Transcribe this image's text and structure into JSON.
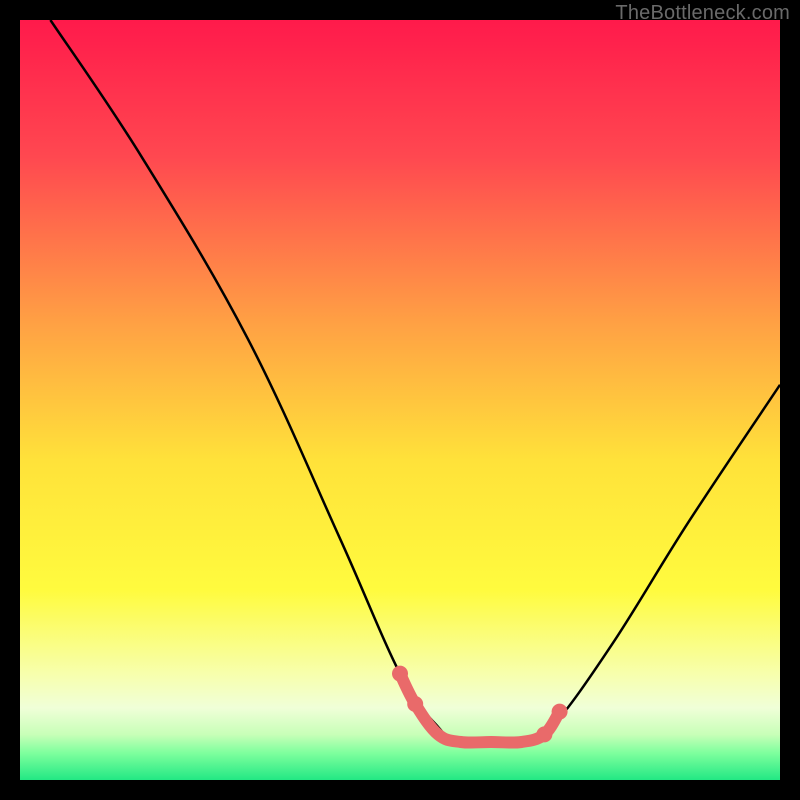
{
  "watermark": "TheBottleneck.com",
  "chart_data": {
    "type": "line",
    "title": "",
    "xlabel": "",
    "ylabel": "",
    "xlim": [
      0,
      100
    ],
    "ylim": [
      0,
      100
    ],
    "gradient_stops": [
      {
        "offset": 0,
        "color": "#ff1a4b"
      },
      {
        "offset": 0.18,
        "color": "#ff4850"
      },
      {
        "offset": 0.4,
        "color": "#ffa144"
      },
      {
        "offset": 0.58,
        "color": "#ffe23a"
      },
      {
        "offset": 0.75,
        "color": "#fffb3e"
      },
      {
        "offset": 0.86,
        "color": "#f7ffac"
      },
      {
        "offset": 0.905,
        "color": "#f0ffd8"
      },
      {
        "offset": 0.94,
        "color": "#c8ffb8"
      },
      {
        "offset": 0.965,
        "color": "#7dff9d"
      },
      {
        "offset": 1.0,
        "color": "#22e884"
      }
    ],
    "series": [
      {
        "name": "bottleneck-curve",
        "color": "#000000",
        "points": [
          {
            "x": 4,
            "y": 100
          },
          {
            "x": 16,
            "y": 82
          },
          {
            "x": 30,
            "y": 58
          },
          {
            "x": 42,
            "y": 32
          },
          {
            "x": 50,
            "y": 14
          },
          {
            "x": 55,
            "y": 7
          },
          {
            "x": 58,
            "y": 5
          },
          {
            "x": 66,
            "y": 5
          },
          {
            "x": 70,
            "y": 7
          },
          {
            "x": 78,
            "y": 18
          },
          {
            "x": 88,
            "y": 34
          },
          {
            "x": 100,
            "y": 52
          }
        ]
      },
      {
        "name": "highlight-segment",
        "color": "#e96a6a",
        "points": [
          {
            "x": 50,
            "y": 14
          },
          {
            "x": 52,
            "y": 10
          },
          {
            "x": 55,
            "y": 6
          },
          {
            "x": 58,
            "y": 5
          },
          {
            "x": 62,
            "y": 5
          },
          {
            "x": 66,
            "y": 5
          },
          {
            "x": 69,
            "y": 6
          },
          {
            "x": 71,
            "y": 9
          }
        ],
        "markers": [
          {
            "x": 50,
            "y": 14
          },
          {
            "x": 52,
            "y": 10
          },
          {
            "x": 69,
            "y": 6
          },
          {
            "x": 71,
            "y": 9
          }
        ]
      }
    ]
  }
}
